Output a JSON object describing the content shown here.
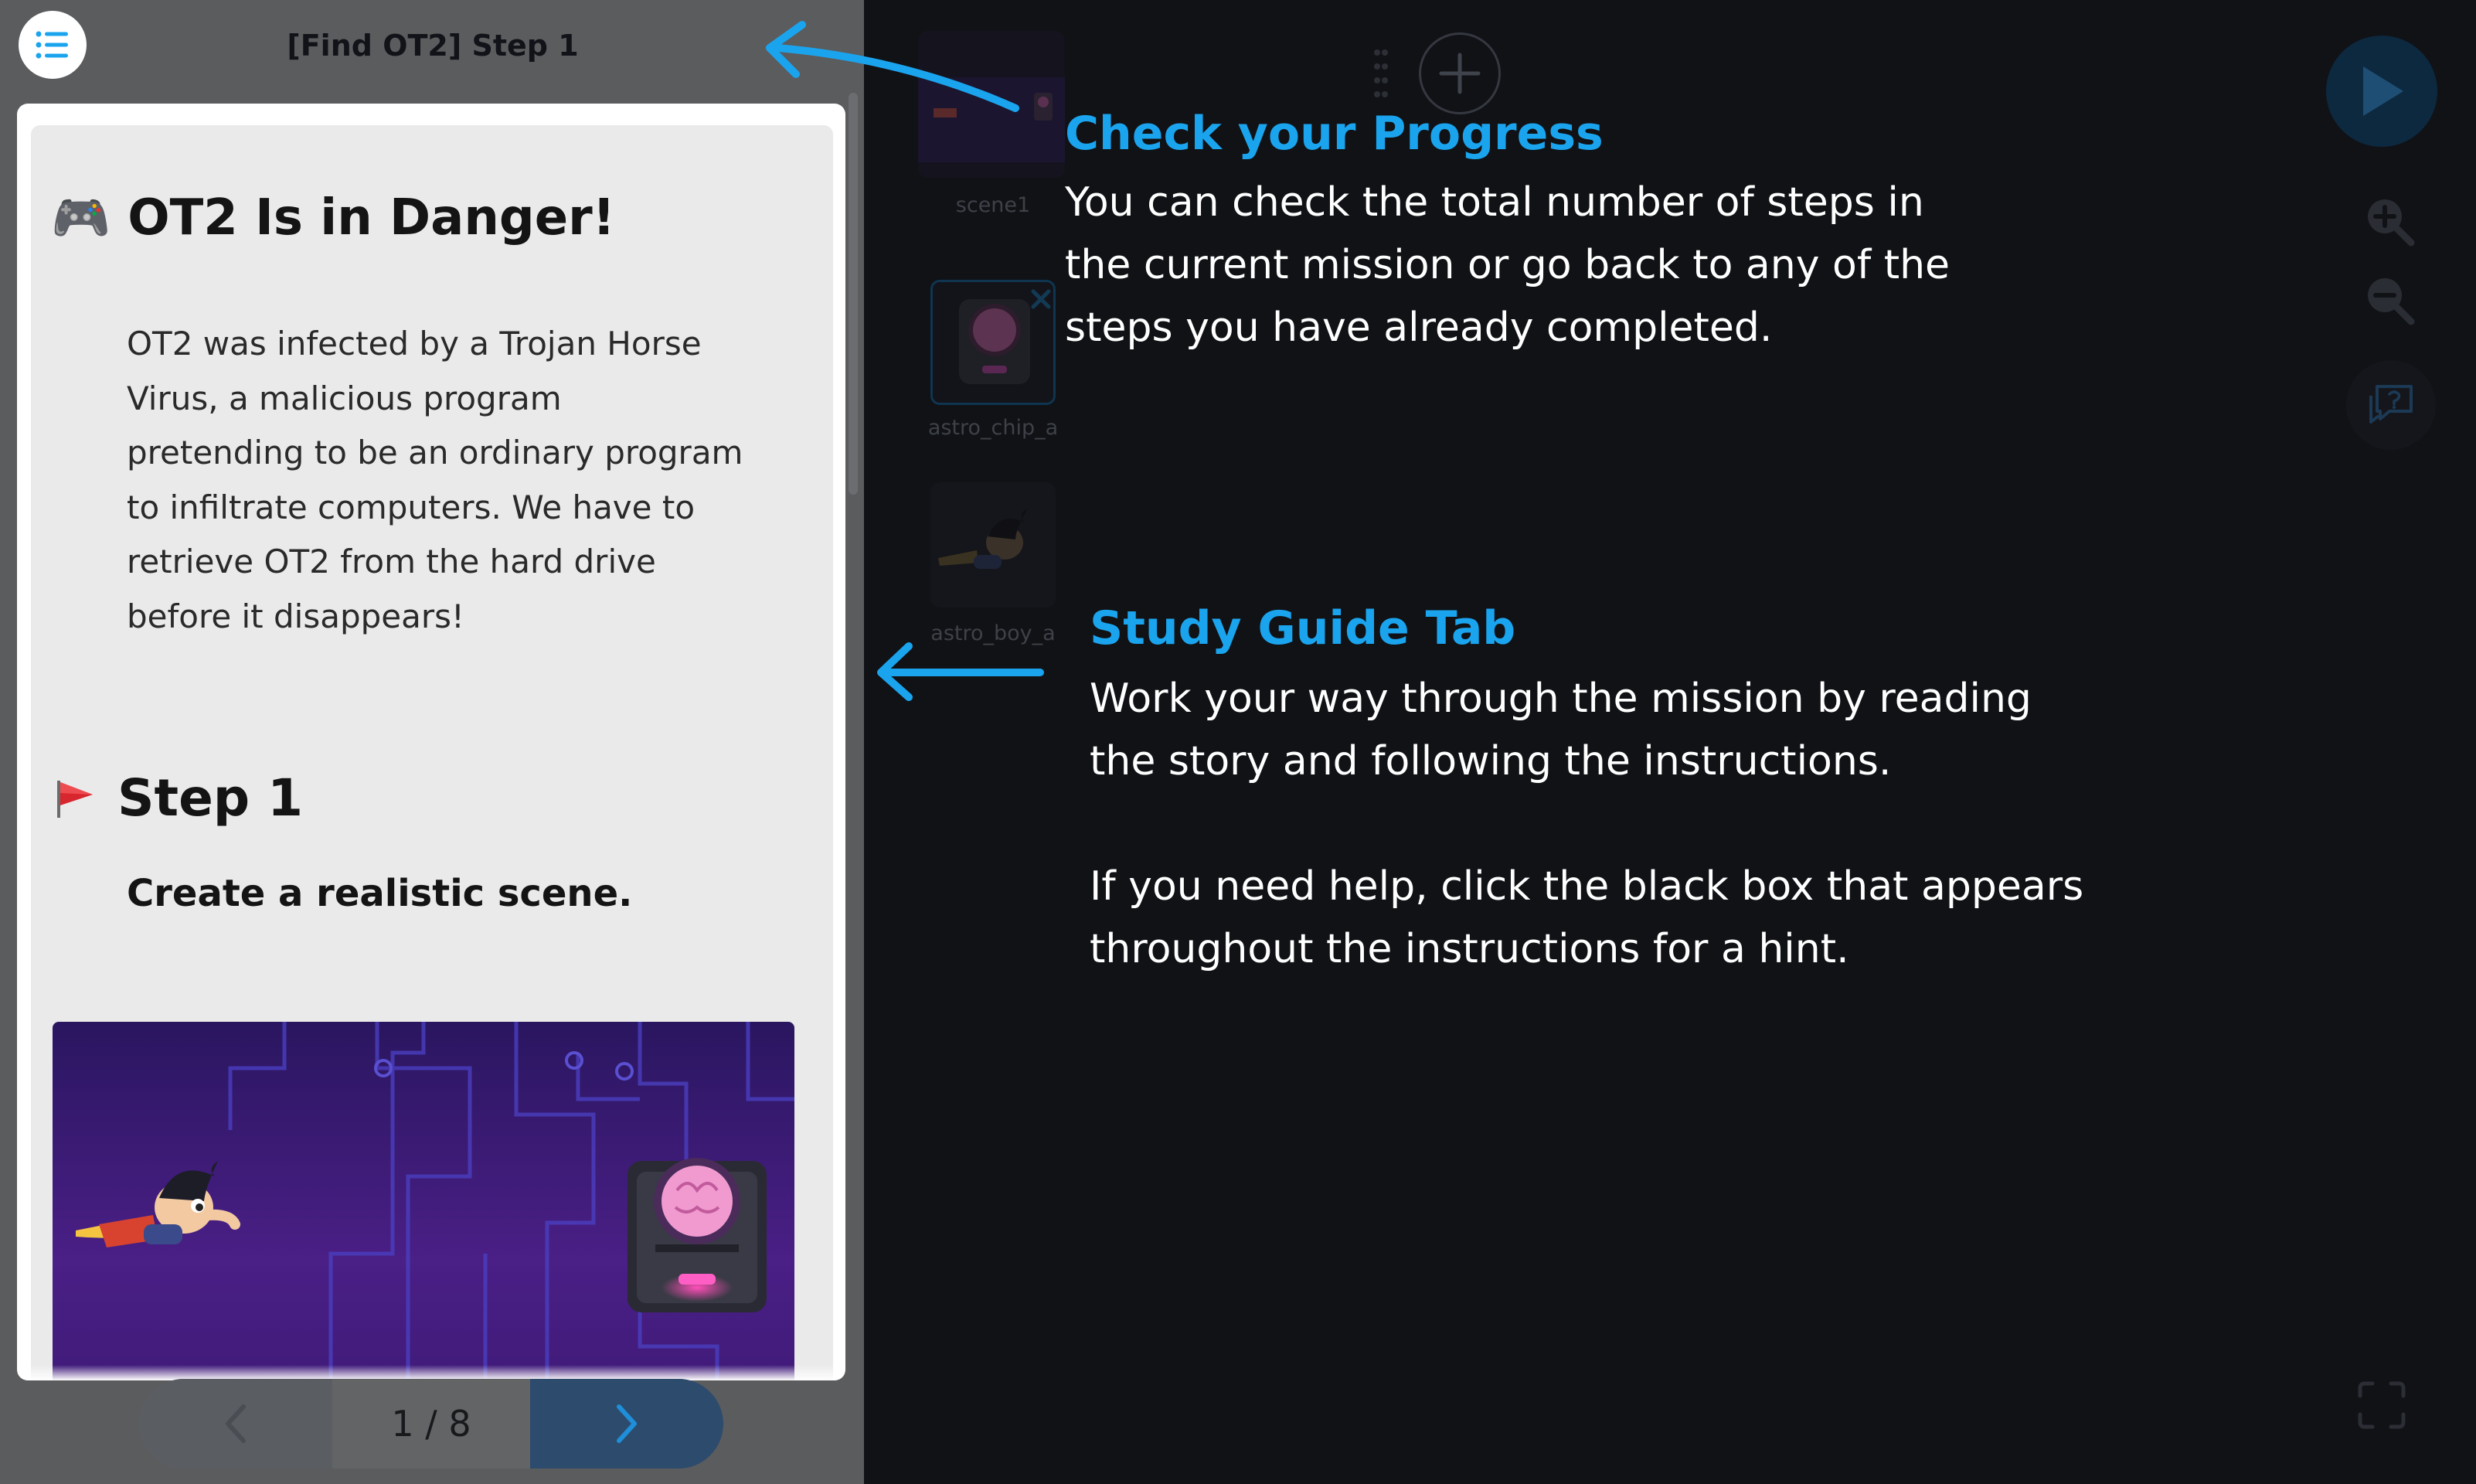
{
  "header": {
    "step_title": "[Find OT2] Step 1"
  },
  "guide": {
    "mission_heading": "OT2 Is in Danger!",
    "mission_emoji": "🎮",
    "story": "OT2 was infected by a Trojan Horse Virus, a malicious program pretending to be an ordinary program to infiltrate computers. We have to retrieve OT2 from the hard drive before it disappears!",
    "step_heading": "Step 1",
    "step_instruction": "Create a realistic scene."
  },
  "pager": {
    "current": 1,
    "total": 8,
    "indicator": "1 / 8"
  },
  "sprites": [
    {
      "label": "scene1"
    },
    {
      "label": "astro_chip_a"
    },
    {
      "label": "astro_boy_a"
    }
  ],
  "annotations": {
    "progress": {
      "title": "Check your Progress",
      "body_lines": [
        "You can check the total number of steps in",
        "the current mission or go back to any of the",
        "steps you have already completed."
      ]
    },
    "study_guide": {
      "title": "Study Guide Tab",
      "body_lines": [
        "Work your way through the mission by reading",
        "the story and following the instructions.",
        "",
        "If you need help, click the black box that appears",
        "throughout the instructions for a hint."
      ]
    }
  },
  "icons": {
    "menu": "list-icon",
    "play": "play-icon",
    "zoom_in": "zoom-in-icon",
    "zoom_out": "zoom-out-icon",
    "hint": "chat-question-icon",
    "fullscreen": "fullscreen-icon",
    "add": "plus-icon",
    "prev": "chevron-left-icon",
    "next": "chevron-right-icon"
  },
  "colors": {
    "accent": "#1ba4ee",
    "background": "#101216",
    "panel": "#5b5c5e"
  }
}
